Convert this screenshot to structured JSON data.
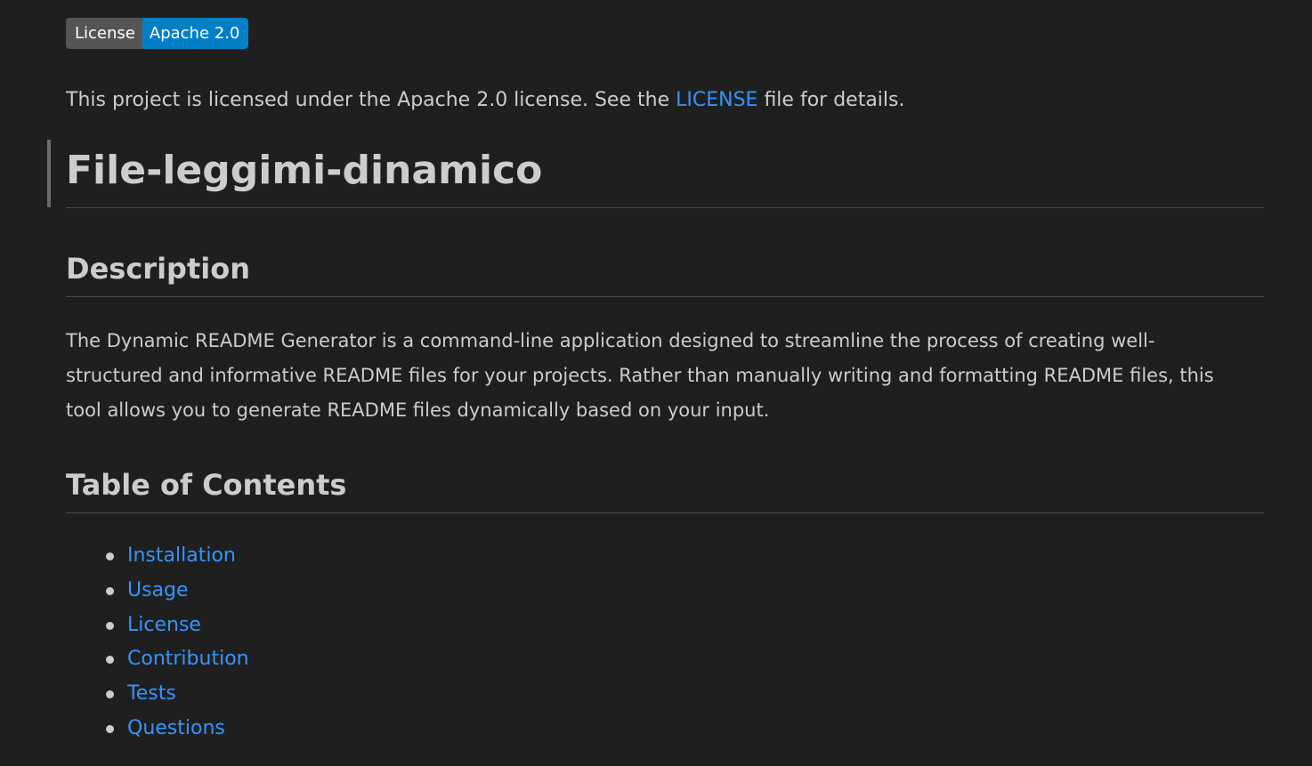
{
  "badge": {
    "label": "License",
    "value": "Apache 2.0",
    "label_color": "#555555",
    "value_color": "#007ec6"
  },
  "license_line": {
    "before": "This project is licensed under the Apache 2.0 license. See the",
    "link": "LICENSE",
    "after": "file for details."
  },
  "title": "File-leggimi-dinamico",
  "description": {
    "heading": "Description",
    "text": "The Dynamic README Generator is a command-line application designed to streamline the process of creating well-structured and informative README files for your projects. Rather than manually writing and formatting README files, this tool allows you to generate README files dynamically based on your input."
  },
  "toc": {
    "heading": "Table of Contents",
    "items": [
      {
        "label": "Installation"
      },
      {
        "label": "Usage"
      },
      {
        "label": "License"
      },
      {
        "label": "Contribution"
      },
      {
        "label": "Tests"
      },
      {
        "label": "Questions"
      }
    ]
  },
  "colors": {
    "background": "#1f1f1f",
    "text": "#cccccc",
    "link": "#3794ff"
  }
}
